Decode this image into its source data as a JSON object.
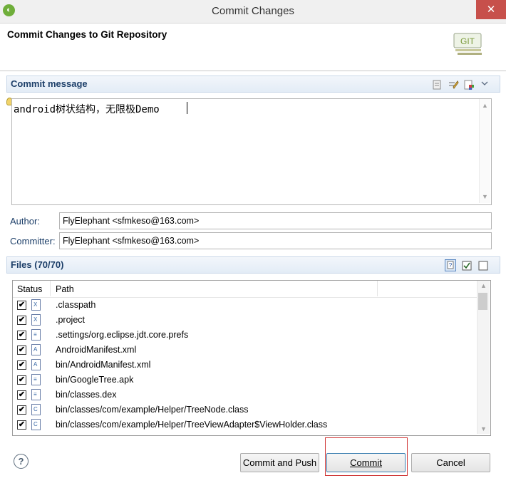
{
  "window": {
    "title": "Commit Changes",
    "close_glyph": "✕"
  },
  "banner": {
    "title": "Commit Changes to Git Repository",
    "logo_text": "GIT"
  },
  "commit_message": {
    "section_title": "Commit message",
    "text": "android树状结构，无限极Demo"
  },
  "author": {
    "label": "Author:",
    "value": "FlyElephant <sfmkeso@163.com>"
  },
  "committer": {
    "label": "Committer:",
    "value": "FlyElephant <sfmkeso@163.com>"
  },
  "files": {
    "section_title": "Files (70/70)",
    "columns": [
      "Status",
      "Path"
    ],
    "rows": [
      {
        "checked": true,
        "icon": "xml-file-icon",
        "path": ".classpath"
      },
      {
        "checked": true,
        "icon": "xml-file-icon",
        "path": ".project"
      },
      {
        "checked": true,
        "icon": "text-file-icon",
        "path": ".settings/org.eclipse.jdt.core.prefs"
      },
      {
        "checked": true,
        "icon": "manifest-file-icon",
        "path": "AndroidManifest.xml"
      },
      {
        "checked": true,
        "icon": "manifest-file-icon",
        "path": "bin/AndroidManifest.xml"
      },
      {
        "checked": true,
        "icon": "text-file-icon",
        "path": "bin/GoogleTree.apk"
      },
      {
        "checked": true,
        "icon": "text-file-icon",
        "path": "bin/classes.dex"
      },
      {
        "checked": true,
        "icon": "class-file-icon",
        "path": "bin/classes/com/example/Helper/TreeNode.class"
      },
      {
        "checked": true,
        "icon": "class-file-icon",
        "path": "bin/classes/com/example/Helper/TreeViewAdapter$ViewHolder.class"
      }
    ]
  },
  "buttons": {
    "commit_and_push": "Commit and Push",
    "commit": "Commit",
    "cancel": "Cancel",
    "help": "?"
  }
}
